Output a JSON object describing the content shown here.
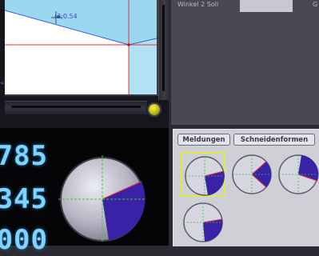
{
  "chart_panel": {
    "point_label": "(3;0.54",
    "corner_mark": "<"
  },
  "top_panel": {
    "winkel_label": "Winkel 2 Soll",
    "winkel_value": "",
    "edge_letter": "G"
  },
  "readouts": {
    "row1": "785",
    "row2": "345",
    "row3": "000"
  },
  "tabs": {
    "meldungen": "Meldungen",
    "schneidenformen": "Schneidenformen"
  },
  "blade_dials": [
    {
      "id": "dial-1",
      "selected": true
    },
    {
      "id": "dial-2",
      "selected": false
    },
    {
      "id": "dial-3",
      "selected": false
    },
    {
      "id": "dial-4",
      "selected": false
    }
  ],
  "colors": {
    "accent_blue": "#3a22a6",
    "cut_line": "#d22a3a",
    "guide": "#38c838",
    "selection": "#e2e84a",
    "readout": "#7fd3ff",
    "status_led": "#e6e23a"
  }
}
